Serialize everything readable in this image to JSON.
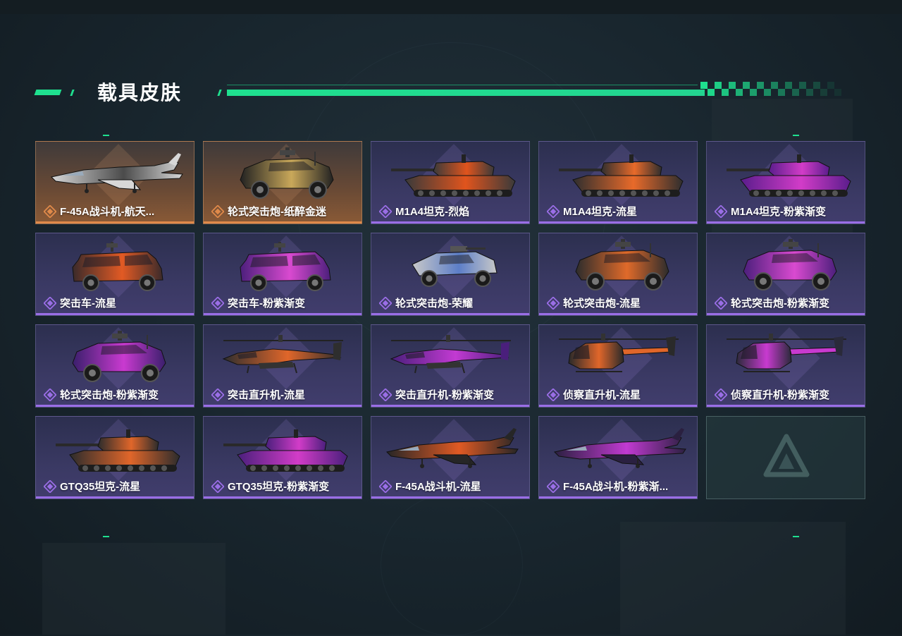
{
  "page": {
    "title": "载具皮肤",
    "accent_color": "#1fe08f"
  },
  "skins": [
    {
      "name": "F-45A战斗机-航天...",
      "rarity": "legendary",
      "vehicle": "jet",
      "colors": [
        "#d7d7d7",
        "#4b4b4b"
      ]
    },
    {
      "name": "轮式突击炮-纸醉金迷",
      "rarity": "legendary",
      "vehicle": "armored-car",
      "colors": [
        "#222222",
        "#c9a85a"
      ]
    },
    {
      "name": "M1A4坦克-烈焰",
      "rarity": "epic",
      "vehicle": "tank",
      "colors": [
        "#3a3a3a",
        "#e0541d"
      ]
    },
    {
      "name": "M1A4坦克-流星",
      "rarity": "epic",
      "vehicle": "tank",
      "colors": [
        "#2e2e2e",
        "#e86a2a"
      ]
    },
    {
      "name": "M1A4坦克-粉紫渐变",
      "rarity": "epic",
      "vehicle": "tank",
      "colors": [
        "#5a1d8c",
        "#d23cc8"
      ]
    },
    {
      "name": "突击车-流星",
      "rarity": "epic",
      "vehicle": "suv",
      "colors": [
        "#3a2a2a",
        "#e25a24"
      ]
    },
    {
      "name": "突击车-粉紫渐变",
      "rarity": "epic",
      "vehicle": "suv",
      "colors": [
        "#4c1f7c",
        "#d94ad0"
      ]
    },
    {
      "name": "轮式突击炮-荣耀",
      "rarity": "epic",
      "vehicle": "buggy",
      "colors": [
        "#c8c8c8",
        "#5c7ec8"
      ]
    },
    {
      "name": "轮式突击炮-流星",
      "rarity": "epic",
      "vehicle": "armored-car",
      "colors": [
        "#2c2c2c",
        "#e06a2a"
      ]
    },
    {
      "name": "轮式突击炮-粉紫渐变",
      "rarity": "epic",
      "vehicle": "armored-car",
      "colors": [
        "#4c1f7c",
        "#d94ad0"
      ]
    },
    {
      "name": "轮式突击炮-粉紫渐变",
      "rarity": "epic",
      "vehicle": "armored-car",
      "colors": [
        "#3a1f6c",
        "#c93ad0"
      ]
    },
    {
      "name": "突击直升机-流星",
      "rarity": "epic",
      "vehicle": "attack-heli",
      "colors": [
        "#2e2e2e",
        "#e0662a"
      ]
    },
    {
      "name": "突击直升机-粉紫渐变",
      "rarity": "epic",
      "vehicle": "attack-heli",
      "colors": [
        "#4a1f7c",
        "#c23ad2"
      ]
    },
    {
      "name": "侦察直升机-流星",
      "rarity": "epic",
      "vehicle": "scout-heli",
      "colors": [
        "#2a2a2a",
        "#e0662a"
      ]
    },
    {
      "name": "侦察直升机-粉紫渐变",
      "rarity": "epic",
      "vehicle": "scout-heli",
      "colors": [
        "#2a2a3a",
        "#c83ad0"
      ]
    },
    {
      "name": "GTQ35坦克-流星",
      "rarity": "epic",
      "vehicle": "tank",
      "colors": [
        "#2c2c2c",
        "#e0662a"
      ]
    },
    {
      "name": "GTQ35坦克-粉紫渐变",
      "rarity": "epic",
      "vehicle": "tank",
      "colors": [
        "#4a1f7c",
        "#d23cc8"
      ]
    },
    {
      "name": "F-45A战斗机-流星",
      "rarity": "epic",
      "vehicle": "jet",
      "colors": [
        "#262626",
        "#e05a24"
      ]
    },
    {
      "name": "F-45A战斗机-粉紫渐...",
      "rarity": "epic",
      "vehicle": "jet",
      "colors": [
        "#2a2040",
        "#c23ad2"
      ]
    }
  ],
  "empty_slot": {
    "icon": "faction-logo-icon"
  },
  "rarity_colors": {
    "legendary": "#e08a4a",
    "epic": "#9a6ee6"
  }
}
